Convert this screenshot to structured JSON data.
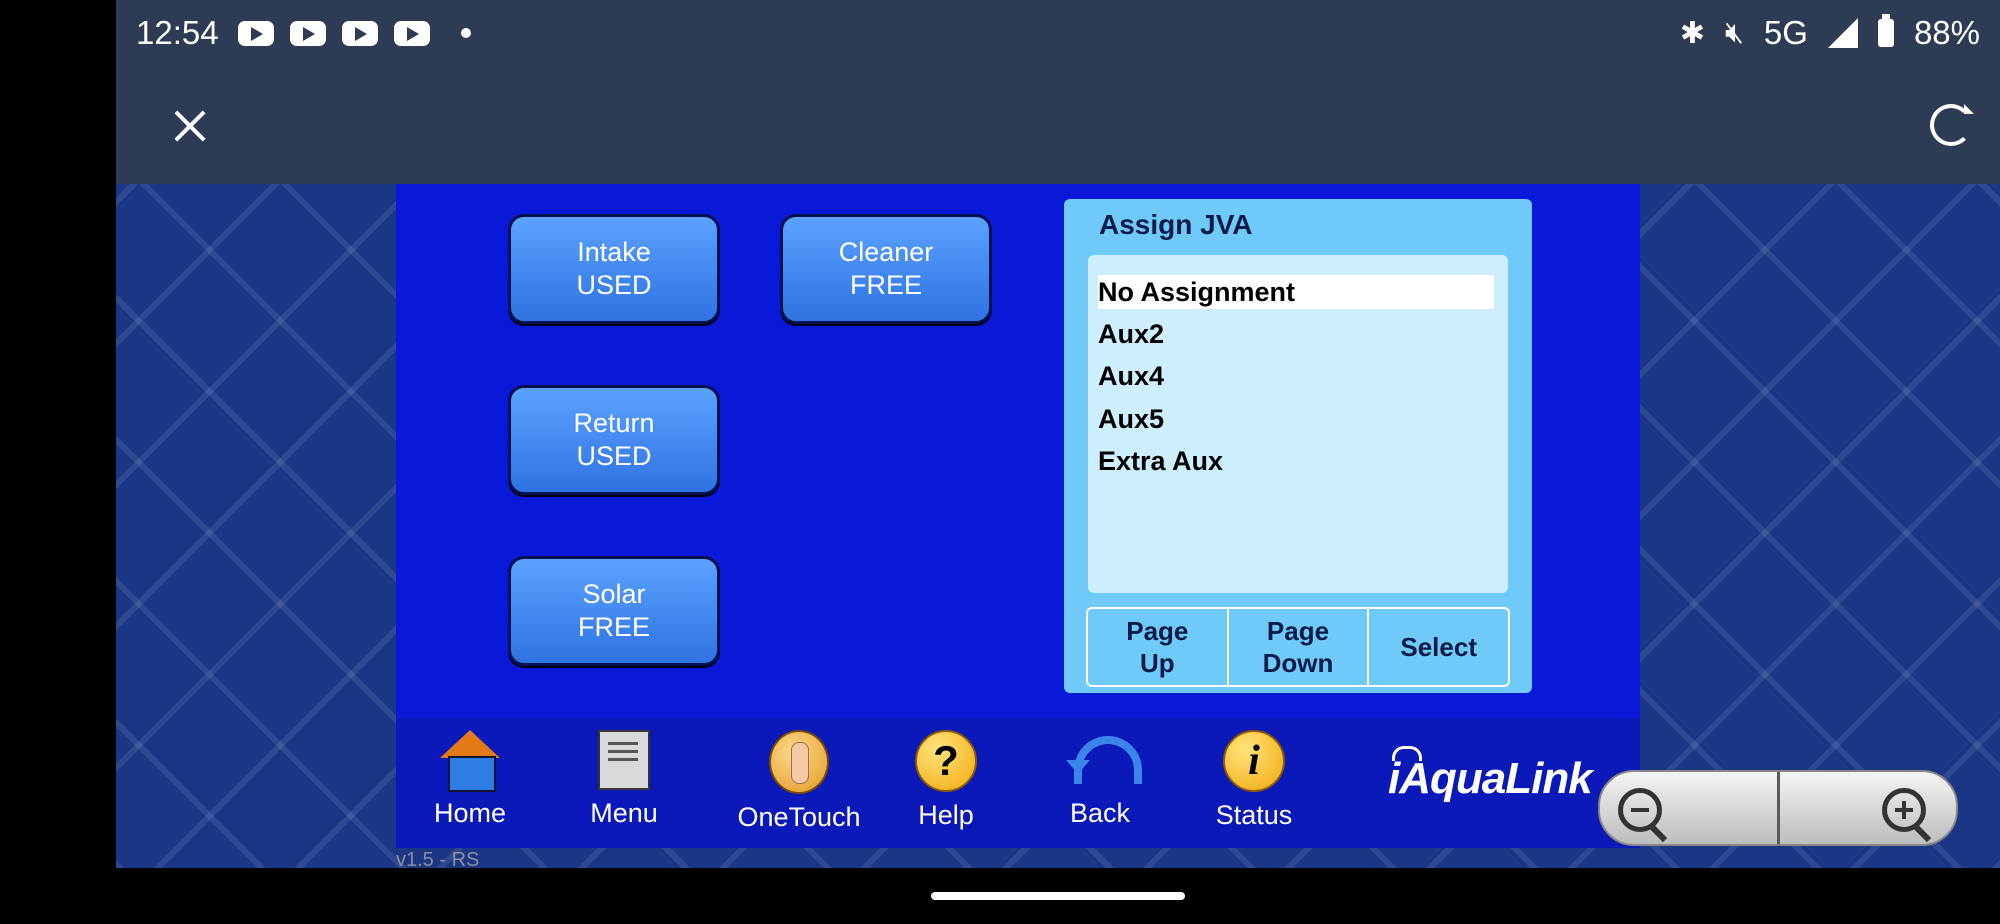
{
  "status_bar": {
    "time": "12:54",
    "notification_icons": [
      "youtube-icon",
      "youtube-icon",
      "youtube-icon",
      "youtube-icon"
    ],
    "network": "5G",
    "battery": "88%"
  },
  "buttons": {
    "intake": {
      "label": "Intake",
      "state": "USED"
    },
    "cleaner": {
      "label": "Cleaner",
      "state": "FREE"
    },
    "return": {
      "label": "Return",
      "state": "USED"
    },
    "solar": {
      "label": "Solar",
      "state": "FREE"
    }
  },
  "assign": {
    "title": "Assign JVA",
    "items": [
      "No Assignment",
      "Aux2",
      "Aux4",
      "Aux5",
      "Extra Aux"
    ],
    "selected": "No Assignment",
    "page_up": [
      "Page",
      "Up"
    ],
    "page_down": [
      "Page",
      "Down"
    ],
    "select": "Select"
  },
  "nav": {
    "home": "Home",
    "menu": "Menu",
    "onetouch": "OneTouch",
    "help": "Help",
    "back": "Back",
    "status": "Status"
  },
  "logo": "iAquaLink",
  "version": "v1.5 - RS"
}
